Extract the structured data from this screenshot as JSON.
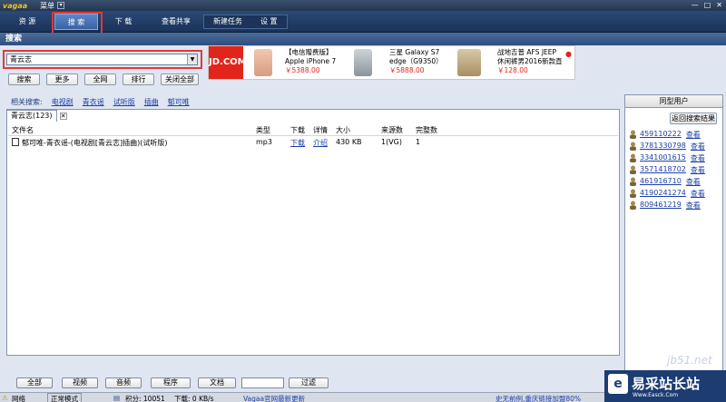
{
  "titlebar": {
    "logo": "vagaa",
    "menu_label": "菜单",
    "min": "—",
    "max": "□",
    "close": "✕"
  },
  "nav": {
    "tabs": [
      "资 源",
      "搜 索",
      "下 载",
      "查看共享"
    ],
    "active": "搜 索",
    "secondary": [
      "新建任务",
      "设 置"
    ]
  },
  "search_header": "搜索",
  "search": {
    "query": "青云志",
    "buttons": [
      "搜索",
      "更多",
      "全网",
      "排行",
      "关闭全部"
    ]
  },
  "ad": {
    "brand": "JD.COM",
    "items": [
      {
        "line1": "【电信赠费版】",
        "line2": "Apple iPhone 7",
        "price": "￥5388.00"
      },
      {
        "line1": "三星 Galaxy S7",
        "line2": "edge（G9350）",
        "price": "￥5888.00"
      },
      {
        "line1": "战地吉普 AFS JEEP",
        "line2": "休闲裤男2016新款直",
        "price": "￥128.00"
      }
    ],
    "badge": "●"
  },
  "related": {
    "label": "相关搜索:",
    "links": [
      "电视剧",
      "青衣谣",
      "试听版",
      "插曲",
      "郁可唯"
    ]
  },
  "result_tab": {
    "label": "青云志(123)",
    "close": "✕"
  },
  "table": {
    "headers": {
      "filename": "文件名",
      "type": "类型",
      "download": "下载",
      "detail": "详情",
      "size": "大小",
      "sources": "来源数",
      "complete": "完整数"
    },
    "rows": [
      {
        "filename": "郁可唯-青衣谣-(电视剧[青云志]插曲)(试听版)",
        "type": "mp3",
        "download": "下载",
        "detail": "介绍",
        "size": "430 KB",
        "sources": "1(VG)",
        "complete": "1"
      }
    ]
  },
  "right_panel": {
    "header": "同型用户",
    "back_button": "返回搜索结果",
    "users": [
      {
        "id": "459110222",
        "action": "查看"
      },
      {
        "id": "3781330798",
        "action": "查看"
      },
      {
        "id": "3341001615",
        "action": "查看"
      },
      {
        "id": "3571418702",
        "action": "查看"
      },
      {
        "id": "461916710",
        "action": "查看"
      },
      {
        "id": "4190241274",
        "action": "查看"
      },
      {
        "id": "809461219",
        "action": "查看"
      }
    ]
  },
  "filters": {
    "buttons": [
      "全部",
      "视频",
      "音频",
      "程序",
      "文档"
    ],
    "input_value": "",
    "filter_button": "过滤"
  },
  "statusbar": {
    "network": "网络",
    "mode": "正常模式",
    "points": "积分: 10051",
    "download_speed": "下载: 0 KB/s",
    "news_link": "Vagaa官网最新更新",
    "promo_link": "史无前例,重庆链接加盟80%"
  },
  "watermark": {
    "logo": "e",
    "title": "易采站长站",
    "subtitle": "Www.Easck.Com",
    "faint": "jb51.net"
  },
  "colors": {
    "accent_red": "#e03a3a",
    "link_blue": "#1e40a8",
    "jd_red": "#e1251b"
  }
}
